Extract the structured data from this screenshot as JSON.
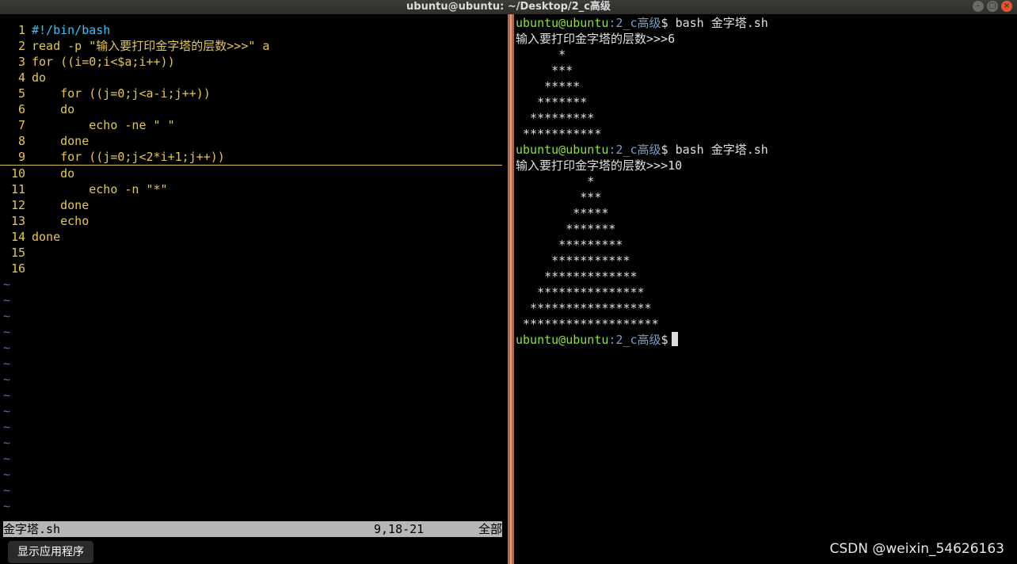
{
  "window": {
    "title": "ubuntu@ubuntu: ~/Desktop/2_c高级",
    "buttons": [
      "–",
      "▢",
      "×"
    ]
  },
  "editor": {
    "lines": [
      {
        "n": "1",
        "text": "#!/bin/bash"
      },
      {
        "n": "2",
        "text": "read -p \"输入要打印金字塔的层数>>>\" a"
      },
      {
        "n": "3",
        "text": "for ((i=0;i<$a;i++))"
      },
      {
        "n": "4",
        "text": "do"
      },
      {
        "n": "5",
        "text": "    for ((j=0;j<a-i;j++))"
      },
      {
        "n": "6",
        "text": "    do"
      },
      {
        "n": "7",
        "text": "        echo -ne \" \""
      },
      {
        "n": "8",
        "text": "    done"
      },
      {
        "n": "9",
        "text": "    for ((j=0;j<2*i+1;j++))"
      },
      {
        "n": "10",
        "text": "    do"
      },
      {
        "n": "11",
        "text": "        echo -n \"*\""
      },
      {
        "n": "12",
        "text": "    done"
      },
      {
        "n": "13",
        "text": "    echo"
      },
      {
        "n": "14",
        "text": "done"
      },
      {
        "n": "15",
        "text": ""
      },
      {
        "n": "16",
        "text": ""
      }
    ],
    "tilde": "~",
    "status": {
      "filename": "金字塔.sh",
      "position": "9,18-21",
      "scroll": "全部"
    }
  },
  "tooltip": "显示应用程序",
  "terminal": {
    "user": "ubuntu@ubuntu",
    "path": ":2_c高级",
    "prompt_symbol": "$",
    "command": " bash 金字塔.sh",
    "input_prompt": "输入要打印金字塔的层数>>>",
    "run1_input": "6",
    "run1_output": [
      "      *",
      "     ***",
      "    *****",
      "   *******",
      "  *********",
      " ***********"
    ],
    "run2_input": "10",
    "run2_output": [
      "          *",
      "         ***",
      "        *****",
      "       *******",
      "      *********",
      "     ***********",
      "    *************",
      "   ***************",
      "  *****************",
      " *******************"
    ]
  },
  "watermark": "CSDN @weixin_54626163"
}
